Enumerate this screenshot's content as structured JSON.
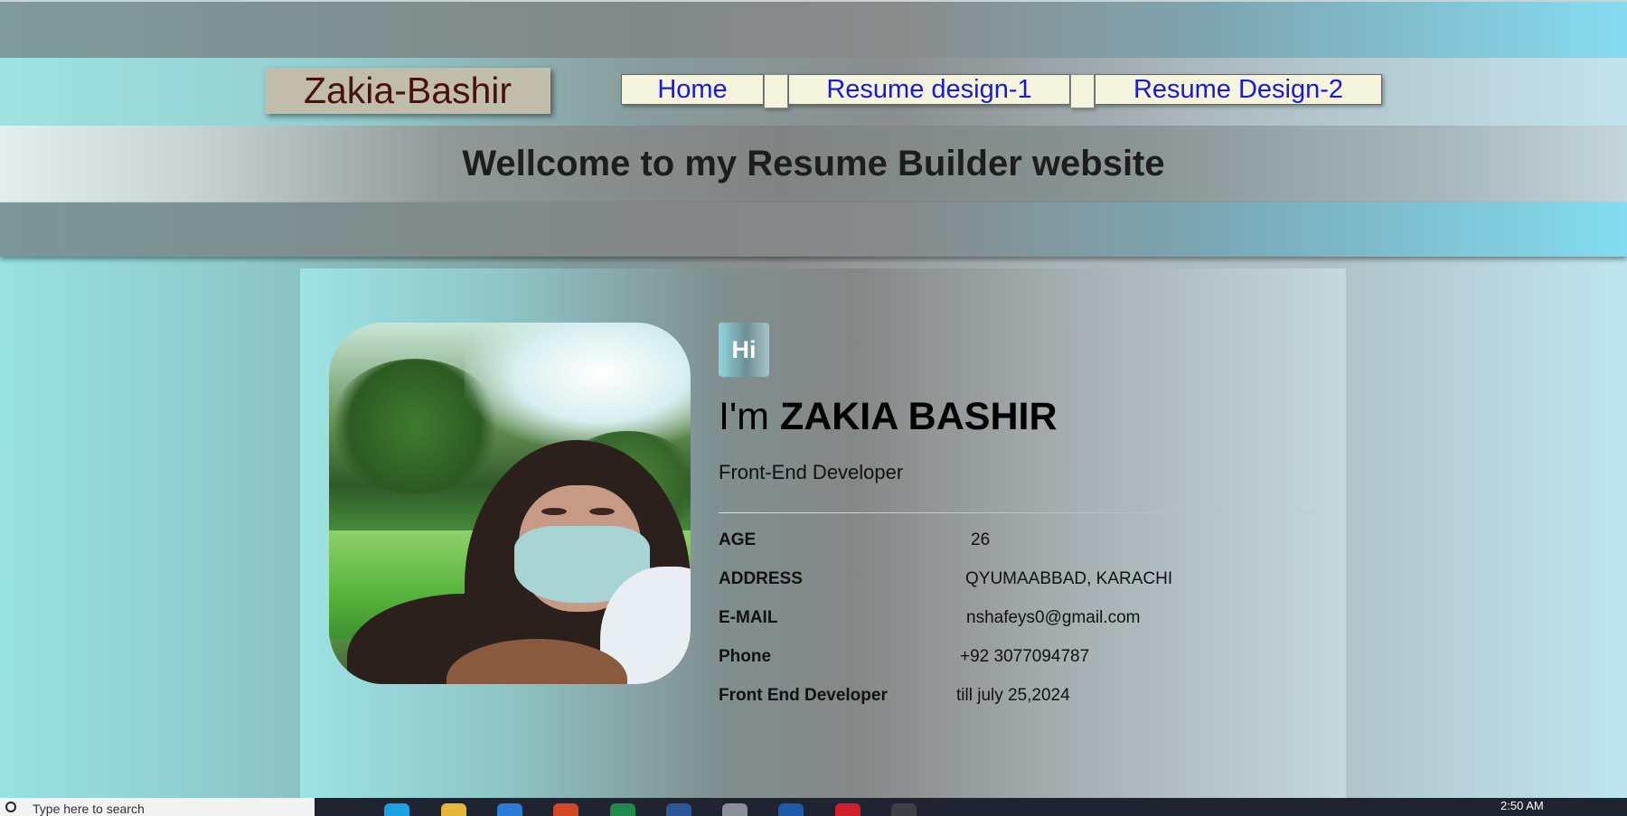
{
  "header": {
    "brand": "Zakia-Bashir",
    "nav": [
      "Home",
      "Resume design-1",
      "Resume Design-2"
    ],
    "welcome": "Wellcome to my Resume Builder website"
  },
  "profile": {
    "badge": "Hi",
    "intro": "I'm",
    "name": "ZAKIA BASHIR",
    "role": "Front-End Developer",
    "info": [
      {
        "label": "AGE",
        "value": "26"
      },
      {
        "label": "ADDRESS",
        "value": "QYUMAABBAD, KARACHI"
      },
      {
        "label": "E-MAIL",
        "value": "nshafeys0@gmail.com"
      },
      {
        "label": "Phone",
        "value": "+92 3077094787"
      },
      {
        "label": "Front End Developer",
        "value": "till july 25,2024"
      }
    ]
  },
  "taskbar": {
    "search_placeholder": "Type here to search",
    "time": "2:50 AM"
  },
  "colors": {
    "brand_text": "#4a120b",
    "nav_link": "#1a1ad4",
    "nav_bg": "#f5f4dc"
  }
}
